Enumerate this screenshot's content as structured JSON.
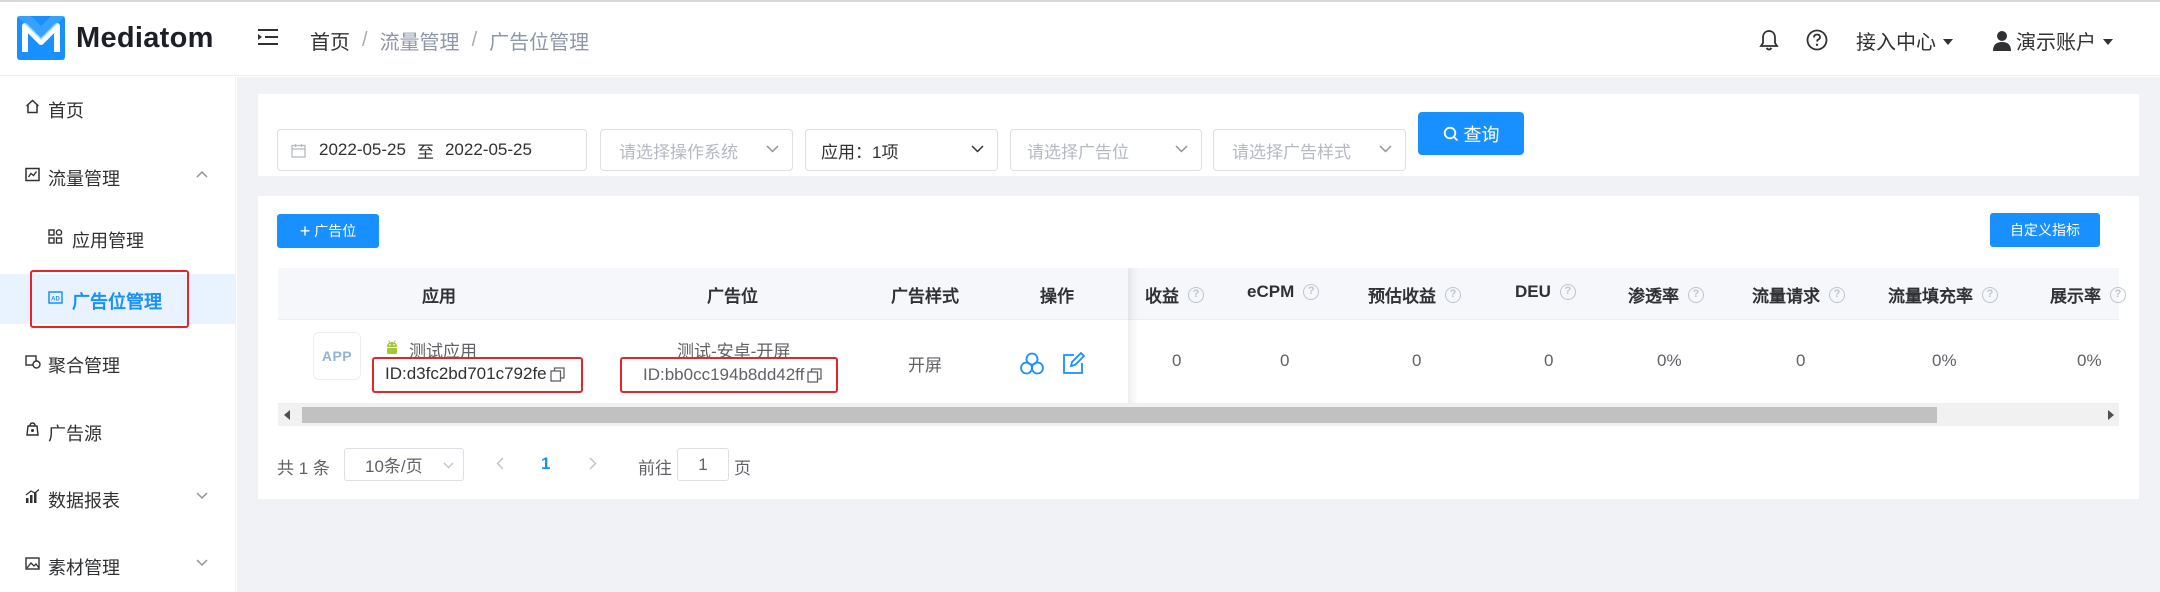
{
  "header": {
    "app_name": "Mediatom",
    "breadcrumb": [
      "首页",
      "流量管理",
      "广告位管理"
    ],
    "access_center": "接入中心",
    "account": "演示账户"
  },
  "sidebar": {
    "items": [
      {
        "label": "首页",
        "icon": "home-icon"
      },
      {
        "label": "流量管理",
        "icon": "chart-icon",
        "expanded": true
      },
      {
        "label": "应用管理",
        "icon": "apps-icon"
      },
      {
        "label": "广告位管理",
        "icon": "ad-icon",
        "active": true
      },
      {
        "label": "聚合管理",
        "icon": "aggregate-icon"
      },
      {
        "label": "广告源",
        "icon": "source-icon"
      },
      {
        "label": "数据报表",
        "icon": "report-icon"
      },
      {
        "label": "素材管理",
        "icon": "image-icon"
      }
    ]
  },
  "filters": {
    "date_start": "2022-05-25",
    "date_sep": "至",
    "date_end": "2022-05-25",
    "os_placeholder": "请选择操作系统",
    "app_value": "应用：1项",
    "adspace_placeholder": "请选择广告位",
    "adstyle_placeholder": "请选择广告样式",
    "query_label": "查询"
  },
  "toolbar": {
    "add_label": "广告位",
    "custom_metrics_label": "自定义指标"
  },
  "table": {
    "columns": [
      "应用",
      "广告位",
      "广告样式",
      "操作",
      "收益",
      "eCPM",
      "预估收益",
      "DEU",
      "渗透率",
      "流量请求",
      "流量填充率",
      "展示率"
    ],
    "rows": [
      {
        "app_icon_text": "APP",
        "app_name": "测试应用",
        "app_id": "ID:d3fc2bd701c792fe",
        "adspace_name": "测试-安卓-开屏",
        "adspace_id": "ID:bb0cc194b8dd42ff",
        "style": "开屏",
        "revenue": "0",
        "ecpm": "0",
        "est_revenue": "0",
        "deu": "0",
        "penetration": "0%",
        "requests": "0",
        "fill_rate": "0%",
        "show_rate": "0%"
      }
    ]
  },
  "pagination": {
    "total": "共 1 条",
    "page_size": "10条/页",
    "current_page": "1",
    "goto_prefix": "前往",
    "goto_value": "1",
    "goto_suffix": "页"
  },
  "colors": {
    "primary": "#1890ff",
    "highlight": "#e7242a",
    "android": "#a4c639"
  }
}
